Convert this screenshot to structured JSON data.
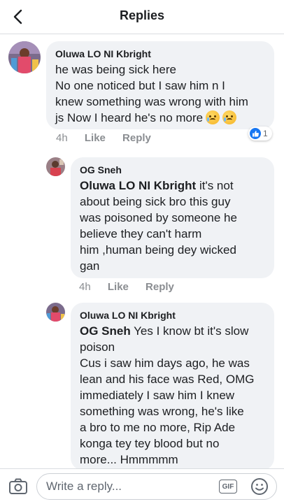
{
  "header": {
    "title": "Replies"
  },
  "comments": [
    {
      "author": "Oluwa LO NI Kbright",
      "lines": [
        "he was being sick here",
        "No one noticed but I saw him n I",
        "knew something was wrong with him",
        "js Now I heard he's no more"
      ],
      "emoji_count": 2,
      "emoji": "crying-face",
      "time": "4h",
      "like_label": "Like",
      "reply_label": "Reply",
      "reaction": {
        "type": "like",
        "count": "1"
      }
    },
    {
      "author": "OG Sneh",
      "mention": "Oluwa LO NI Kbright",
      "lines": [
        "about being sick bro this guy",
        "was poisoned by someone he",
        "believe they can't harm",
        "him ,human being dey wicked",
        "gan"
      ],
      "first_line_rest": " it's not",
      "time": "4h",
      "like_label": "Like",
      "reply_label": "Reply"
    },
    {
      "author": "Oluwa LO NI Kbright",
      "mention": "OG Sneh",
      "first_line_rest": " Yes I know bt it's slow",
      "lines": [
        "poison",
        "Cus i saw him days ago, he was",
        "lean and his face was Red, OMG",
        "immediately I saw him I knew",
        "something was wrong, he's  like",
        "a bro to me no more, Rip Ade",
        "konga tey tey blood but no",
        "more... Hmmmmm"
      ]
    }
  ],
  "composer": {
    "placeholder": "Write a reply...",
    "gif_label": "GIF"
  },
  "colors": {
    "bubble": "#f0f2f5",
    "accent": "#1877f2",
    "muted": "#8a8d91"
  }
}
